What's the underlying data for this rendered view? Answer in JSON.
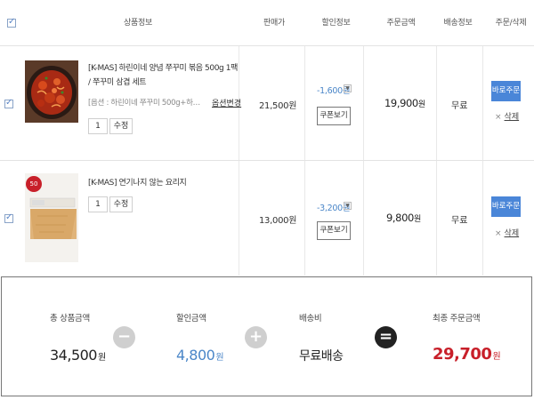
{
  "header": {
    "product_info": "상품정보",
    "sale_price": "판매가",
    "discount_info": "할인정보",
    "order_amount": "주문금액",
    "shipping_info": "배송정보",
    "order_delete": "주문/삭제"
  },
  "items": [
    {
      "name": "[K-MAS] 하린이네 양념 쭈꾸미 볶음 500g 1팩 / 쭈꾸미 삼겹 세트",
      "option": "[옵션 : 하린이네 쭈꾸미 500g+하린이네…",
      "option_change": "옵션변경",
      "qty": "1",
      "qty_edit": "수정",
      "sale_price": "21,500원",
      "discount": "-1,600원",
      "coupon": "쿠폰보기",
      "order_amount": "19,900",
      "won": "원",
      "shipping": "무료",
      "buy_now": "바로주문",
      "delete": "삭제"
    },
    {
      "name": "[K-MAS] 연기나지 않는 요리지",
      "qty": "1",
      "qty_edit": "수정",
      "sale_price": "13,000원",
      "discount": "-3,200원",
      "coupon": "쿠폰보기",
      "order_amount": "9,800",
      "won": "원",
      "shipping": "무료",
      "buy_now": "바로주문",
      "delete": "삭제"
    }
  ],
  "summary": {
    "total_label": "총 상품금액",
    "total_value": "34,500",
    "discount_label": "할인금액",
    "discount_value": "4,800",
    "shipping_label": "배송비",
    "shipping_value": "무료배송",
    "final_label": "최종 주문금액",
    "final_value": "29,700",
    "won": "원",
    "minus_symbol": "−",
    "plus_symbol": "+",
    "equals_symbol": "="
  },
  "colors": {
    "accent_blue": "#4a86d8",
    "discount_blue": "#4a86c8",
    "final_red": "#c8202a",
    "operator_gray": "#cfcfcf",
    "equals_dark": "#222222"
  }
}
